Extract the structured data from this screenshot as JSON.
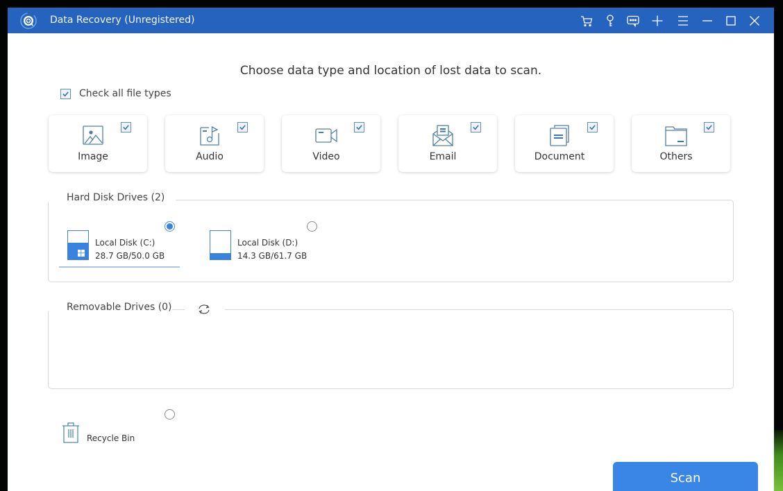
{
  "window": {
    "title": "Data Recovery (Unregistered)",
    "accent_color": "#2563bf",
    "titlebar_icons": [
      "cart-icon",
      "key-icon",
      "chat-icon",
      "plus-icon",
      "menu-icon",
      "minimize-icon",
      "maximize-icon",
      "close-icon"
    ]
  },
  "main": {
    "heading": "Choose data type and location of lost data to scan.",
    "check_all": {
      "label": "Check all file types",
      "checked": true
    },
    "file_types": [
      {
        "label": "Image",
        "icon": "image-icon",
        "checked": true
      },
      {
        "label": "Audio",
        "icon": "audio-icon",
        "checked": true
      },
      {
        "label": "Video",
        "icon": "video-icon",
        "checked": true
      },
      {
        "label": "Email",
        "icon": "email-icon",
        "checked": true
      },
      {
        "label": "Document",
        "icon": "document-icon",
        "checked": true
      },
      {
        "label": "Others",
        "icon": "folder-icon",
        "checked": true
      }
    ]
  },
  "hard_disks": {
    "label": "Hard Disk Drives (2)",
    "drives": [
      {
        "name": "Local Disk (C:)",
        "size": "28.7 GB/50.0 GB",
        "used_fraction": 0.574,
        "selected": true,
        "system": true
      },
      {
        "name": "Local Disk (D:)",
        "size": "14.3 GB/61.7 GB",
        "used_fraction": 0.232,
        "selected": false,
        "system": false
      }
    ]
  },
  "removable": {
    "label": "Removable Drives (0)",
    "refresh_icon": "refresh-icon"
  },
  "recycle_bin": {
    "label": "Recycle Bin",
    "selected": false
  },
  "actions": {
    "scan_label": "Scan",
    "scan_color": "#3a86e6"
  }
}
